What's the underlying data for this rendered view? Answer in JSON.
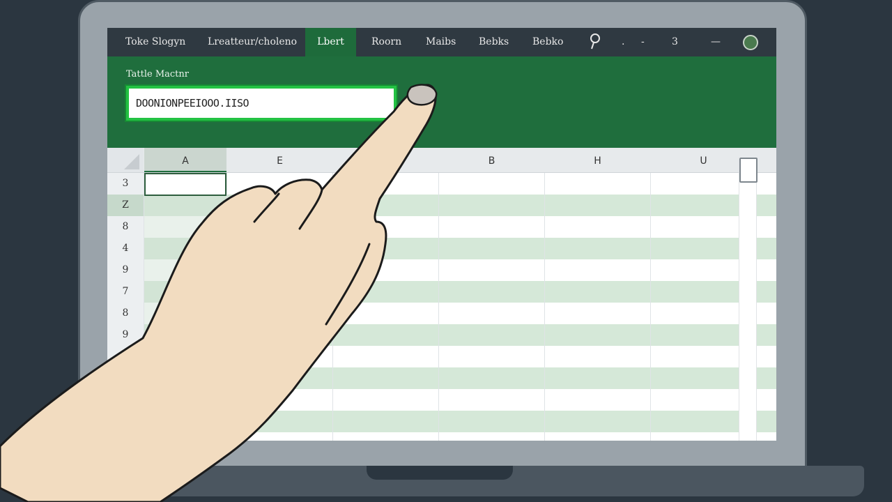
{
  "topbar": {
    "items": [
      {
        "label": "Toke Slogyn",
        "active": false
      },
      {
        "label": "Lreatteur/choleno",
        "active": false
      },
      {
        "label": "Lbert",
        "active": true
      },
      {
        "label": "Roorn",
        "active": false
      },
      {
        "label": "Maibs",
        "active": false
      },
      {
        "label": "Bebks",
        "active": false
      },
      {
        "label": "Bebko",
        "active": false
      }
    ],
    "search_icon": "search-icon",
    "dot": ".",
    "minus1": "-",
    "count": "3",
    "minus2": "—"
  },
  "ribbon": {
    "label": "Tattle Mactnr",
    "formula_value": "DOONIONPEEIOOO.IISO"
  },
  "grid": {
    "columns": [
      "A",
      "E",
      "",
      "B",
      "H",
      "U"
    ],
    "rows": [
      "3",
      "Z",
      "8",
      "4",
      "9",
      "7",
      "8",
      "9",
      "",
      "",
      "",
      ""
    ]
  },
  "colors": {
    "accent": "#1f6e3d",
    "highlight": "#23c243",
    "band": "#d5e8d8",
    "topbar": "#2f3941"
  }
}
